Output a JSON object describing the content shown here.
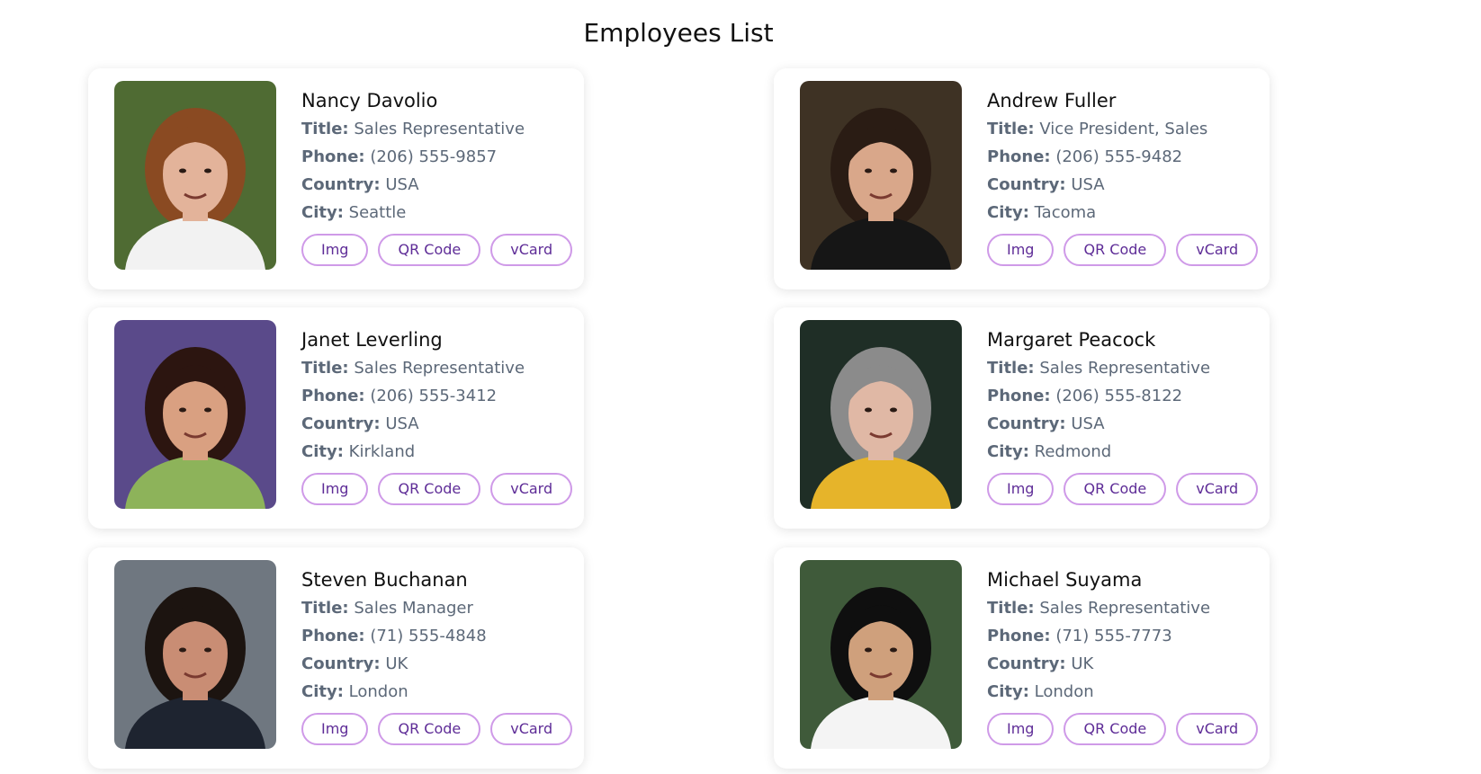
{
  "page": {
    "title": "Employees List"
  },
  "labels": {
    "title": "Title:",
    "phone": "Phone:",
    "country": "Country:",
    "city": "City:"
  },
  "buttons": {
    "img": "Img",
    "qr": "QR Code",
    "vcard": "vCard"
  },
  "employees": [
    {
      "name": "Nancy Davolio",
      "title": "Sales Representative",
      "phone": "(206) 555-9857",
      "country": "USA",
      "city": "Seattle"
    },
    {
      "name": "Andrew Fuller",
      "title": "Vice President, Sales",
      "phone": "(206) 555-9482",
      "country": "USA",
      "city": "Tacoma"
    },
    {
      "name": "Janet Leverling",
      "title": "Sales Representative",
      "phone": "(206) 555-3412",
      "country": "USA",
      "city": "Kirkland"
    },
    {
      "name": "Margaret Peacock",
      "title": "Sales Representative",
      "phone": "(206) 555-8122",
      "country": "USA",
      "city": "Redmond"
    },
    {
      "name": "Steven Buchanan",
      "title": "Sales Manager",
      "phone": "(71) 555-4848",
      "country": "UK",
      "city": "London"
    },
    {
      "name": "Michael Suyama",
      "title": "Sales Representative",
      "phone": "(71) 555-7773",
      "country": "UK",
      "city": "London"
    }
  ],
  "photo_colors": [
    {
      "bg": "#4f6b33",
      "hair": "#8a4a22",
      "skin": "#e3b39a",
      "shirt": "#f2f2f2"
    },
    {
      "bg": "#3e3224",
      "hair": "#2a1c14",
      "skin": "#d9a78a",
      "shirt": "#161616"
    },
    {
      "bg": "#5a4a8a",
      "hair": "#2c1510",
      "skin": "#d9a081",
      "shirt": "#8db35a"
    },
    {
      "bg": "#1f2e26",
      "hair": "#8b8b8b",
      "skin": "#e0b8a5",
      "shirt": "#e6b42a"
    },
    {
      "bg": "#6f7780",
      "hair": "#1c1410",
      "skin": "#c98d74",
      "shirt": "#1e2430"
    },
    {
      "bg": "#3f5a3a",
      "hair": "#0f0f0f",
      "skin": "#cfa07c",
      "shirt": "#f4f4f4"
    }
  ]
}
